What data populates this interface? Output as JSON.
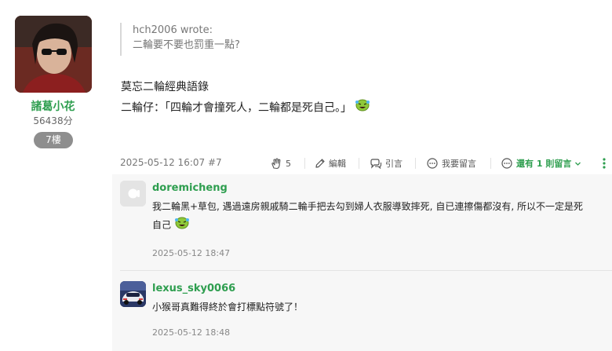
{
  "author": {
    "name": "諸葛小花",
    "points": "56438分",
    "floor": "7樓"
  },
  "quote": {
    "author": "hch2006 wrote:",
    "text": "二輪要不要也罰重一點?"
  },
  "post": {
    "line1": "莫忘二輪經典語錄",
    "line2": "二輪仔：「四輪才會撞死人，二輪都是死自己。」"
  },
  "meta": {
    "date": "2025-05-12 16:07 #7",
    "like_count": "5",
    "edit_label": "編輯",
    "quote_label": "引言",
    "comment_label": "我要留言",
    "more_comments_label": "還有 1 則留言"
  },
  "replies": [
    {
      "user": "doremicheng",
      "text_line1": "我二輪黑+草包, 遇過遠房親戚騎二輪手把去勾到婦人衣服導致摔死, 自已連擦傷都沒有, 所以不一定是死",
      "text_line2": "自己",
      "date": "2025-05-12 18:47"
    },
    {
      "user": "lexus_sky0066",
      "text_line1": "小猴哥真難得終於會打標點符號了！",
      "date": "2025-05-12 18:48"
    }
  ],
  "colors": {
    "accent": "#2e9e4f",
    "badge": "#8e8e8e",
    "reply_bg": "#f7f7f7"
  },
  "icons": [
    "clap-icon",
    "pencil-icon",
    "quote-icon",
    "comment-icon",
    "more-comments-icon",
    "kebab-icon",
    "laughing-crying-emoji"
  ]
}
